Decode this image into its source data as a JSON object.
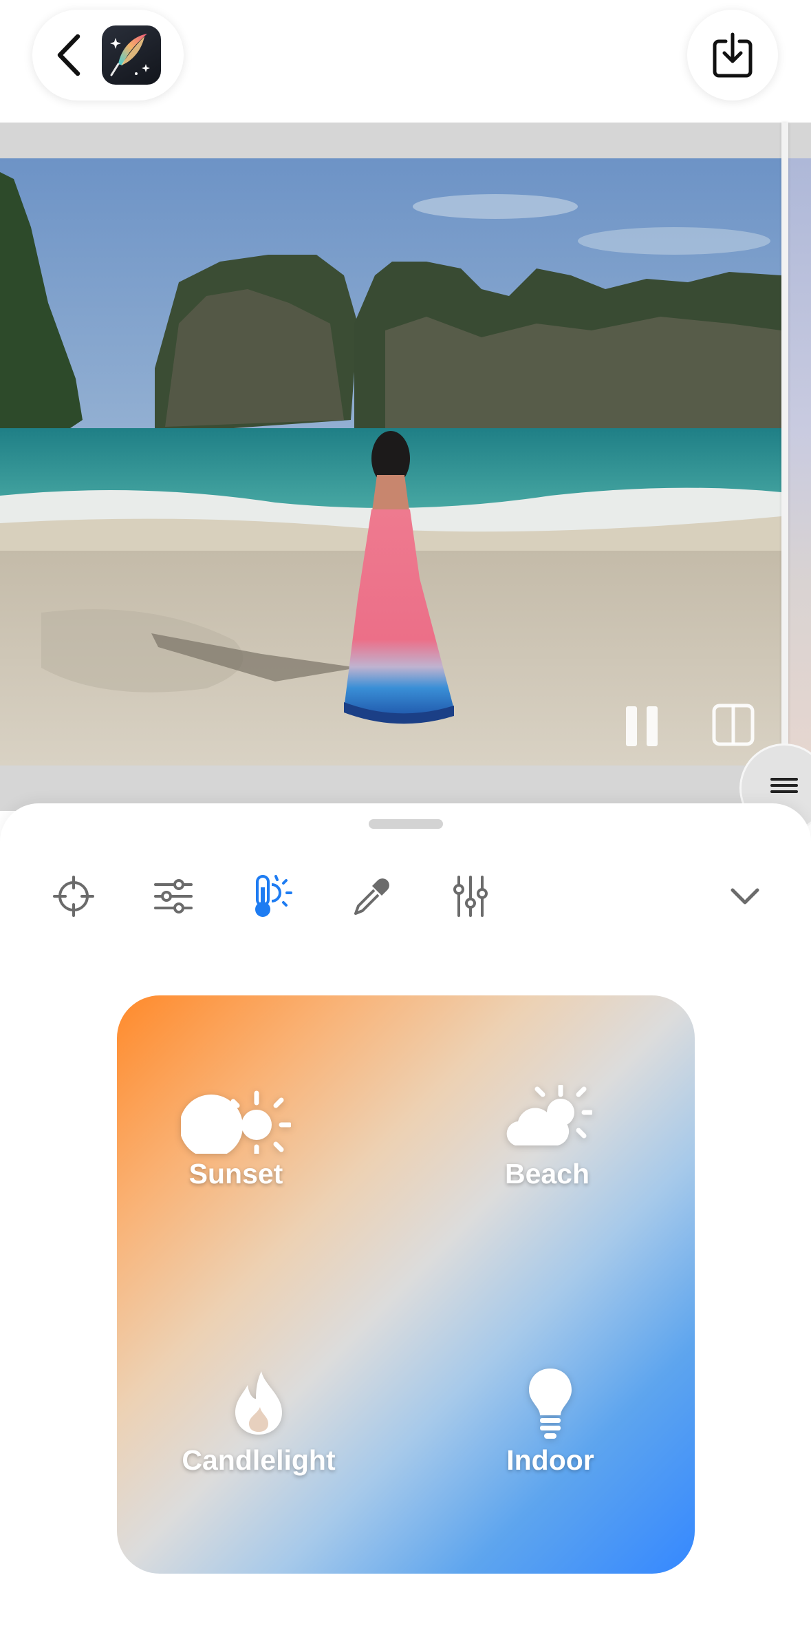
{
  "header": {
    "back_icon": "chevron-left-icon",
    "app_icon": "feather-sparkle-icon",
    "export_icon": "download-tray-icon"
  },
  "preview": {
    "image": "beach with limestone cliffs, woman in pink dress",
    "pause_icon": "pause-icon",
    "compare_icon": "split-view-icon",
    "handle_icon": "drag-handle-icon"
  },
  "toolbar": {
    "tools": [
      {
        "icon": "crosshair-icon",
        "active": false
      },
      {
        "icon": "sliders-horizontal-icon",
        "active": false
      },
      {
        "icon": "thermometer-sun-icon",
        "active": true
      },
      {
        "icon": "eyedropper-icon",
        "active": false
      },
      {
        "icon": "sliders-vertical-icon",
        "active": false
      }
    ],
    "collapse_icon": "chevron-down-icon",
    "active_color": "#1e7cf2",
    "inactive_color": "#6b6b6b"
  },
  "presets": [
    {
      "label": "Sunset",
      "icon": "sunset-icon"
    },
    {
      "label": "Beach",
      "icon": "partly-sunny-icon"
    },
    {
      "label": "Candlelight",
      "icon": "flame-icon"
    },
    {
      "label": "Indoor",
      "icon": "lightbulb-icon"
    }
  ],
  "colors": {
    "warm_accent": "#ff8a2b",
    "cool_accent": "#3588ff"
  }
}
